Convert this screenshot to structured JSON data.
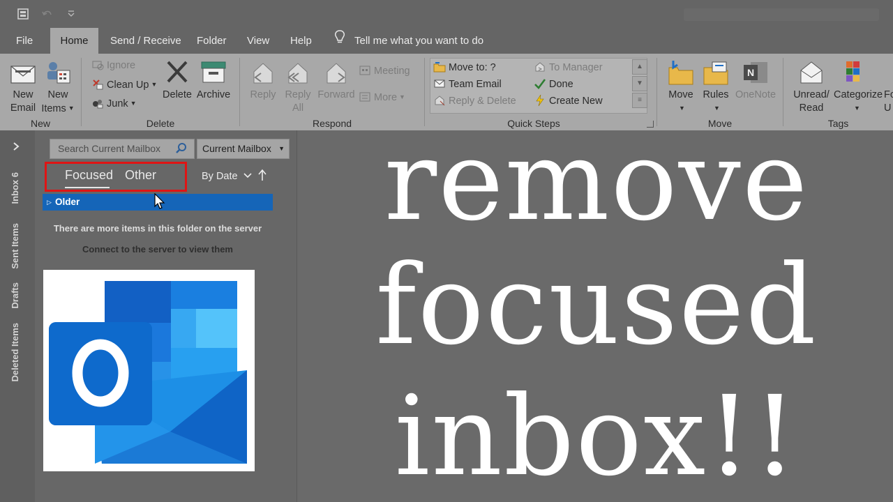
{
  "quick_access": {
    "app_icon": "outlook-sync-icon",
    "undo_icon": "undo-icon",
    "customize_icon": "chevron-down-icon"
  },
  "menu": {
    "tabs": [
      {
        "label": "File"
      },
      {
        "label": "Home",
        "active": true
      },
      {
        "label": "Send / Receive"
      },
      {
        "label": "Folder"
      },
      {
        "label": "View"
      },
      {
        "label": "Help"
      }
    ],
    "tell_me": "Tell me what you want to do"
  },
  "ribbon": {
    "new": {
      "label": "New",
      "new_email": [
        "New",
        "Email"
      ],
      "new_items": [
        "New",
        "Items"
      ]
    },
    "delete": {
      "label": "Delete",
      "ignore": "Ignore",
      "clean_up": "Clean Up",
      "junk": "Junk",
      "delete_btn": "Delete",
      "archive": "Archive"
    },
    "respond": {
      "label": "Respond",
      "reply": "Reply",
      "reply_all": [
        "Reply",
        "All"
      ],
      "forward": "Forward",
      "meeting": "Meeting",
      "more": "More"
    },
    "quick_steps": {
      "label": "Quick Steps",
      "items": [
        "Move to: ?",
        "Team Email",
        "Reply & Delete",
        "To Manager",
        "Done",
        "Create New"
      ]
    },
    "move": {
      "label": "Move",
      "move_btn": "Move",
      "rules": "Rules",
      "onenote": "OneNote"
    },
    "tags": {
      "label": "Tags",
      "unread_read": [
        "Unread/",
        "Read"
      ],
      "categorize": "Categorize",
      "follow_up_cut": [
        "Fo",
        "U"
      ]
    }
  },
  "nav": {
    "folders": [
      "Inbox 6",
      "Sent Items",
      "Drafts",
      "Deleted Items"
    ]
  },
  "message_list": {
    "search_placeholder": "Search Current Mailbox",
    "scope": "Current Mailbox",
    "tabs": {
      "focused": "Focused",
      "other": "Other"
    },
    "sort": "By Date",
    "group": "Older",
    "info_line1": "There are more items in this folder on the server",
    "info_line2": "Connect to the server to view them"
  },
  "overlay": {
    "line1": "remove",
    "line2": "focused",
    "line3": "inbox!!"
  },
  "colors": {
    "highlight_box": "#e01414",
    "selected_row": "#1565b8",
    "outlook_blue": "#0a64c8"
  }
}
